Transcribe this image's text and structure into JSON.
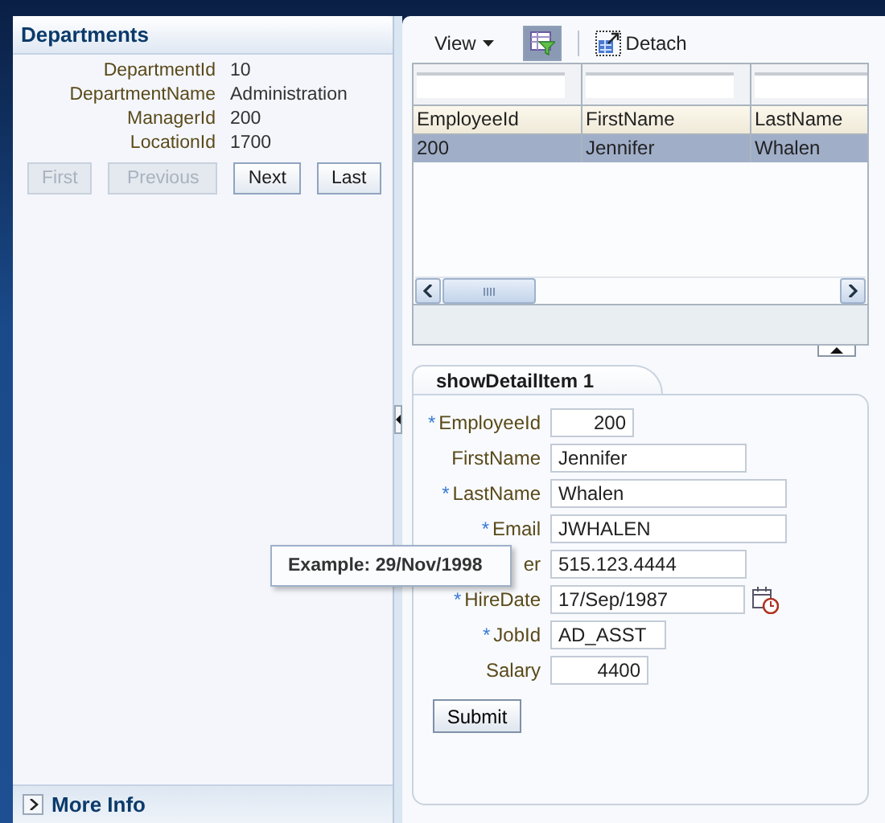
{
  "departments": {
    "title": "Departments",
    "fields": [
      {
        "label": "DepartmentId",
        "value": "10"
      },
      {
        "label": "DepartmentName",
        "value": "Administration"
      },
      {
        "label": "ManagerId",
        "value": "200"
      },
      {
        "label": "LocationId",
        "value": "1700"
      }
    ],
    "buttons": [
      {
        "label": "First",
        "disabled": true
      },
      {
        "label": "Previous",
        "disabled": true
      },
      {
        "label": "Next",
        "disabled": false
      },
      {
        "label": "Last",
        "disabled": false
      }
    ]
  },
  "more_info": {
    "label": "More Info",
    "expanded": false
  },
  "toolbar": {
    "view_menu": "View",
    "filter_toggle": {
      "selected": true
    },
    "detach": "Detach"
  },
  "table": {
    "columns": [
      "EmployeeId",
      "FirstName",
      "LastName"
    ],
    "rows": [
      {
        "cells": [
          "200",
          "Jennifer",
          "Whalen"
        ],
        "selected": true
      }
    ]
  },
  "detail_tab": {
    "label": "showDetailItem 1",
    "selected": true
  },
  "form": {
    "fields": [
      {
        "label": "EmployeeId",
        "value": "200",
        "required_mark": "*",
        "kind": "number"
      },
      {
        "label": "FirstName",
        "value": "Jennifer",
        "kind": "text"
      },
      {
        "label": "LastName",
        "value": "Whalen",
        "required_mark": "*",
        "kind": "text"
      },
      {
        "label": "Email",
        "value": "JWHALEN",
        "required_mark": "*",
        "kind": "text"
      },
      {
        "label": "er",
        "value": "515.123.4444",
        "kind": "text"
      },
      {
        "label": "HireDate",
        "value": "17/Sep/1987",
        "required_mark": "*",
        "kind": "date"
      },
      {
        "label": "JobId",
        "value": "AD_ASST",
        "required_mark": "*",
        "kind": "text"
      },
      {
        "label": "Salary",
        "value": "4400",
        "kind": "number"
      }
    ],
    "submit": "Submit"
  },
  "tooltip": "Example: 29/Nov/1998"
}
